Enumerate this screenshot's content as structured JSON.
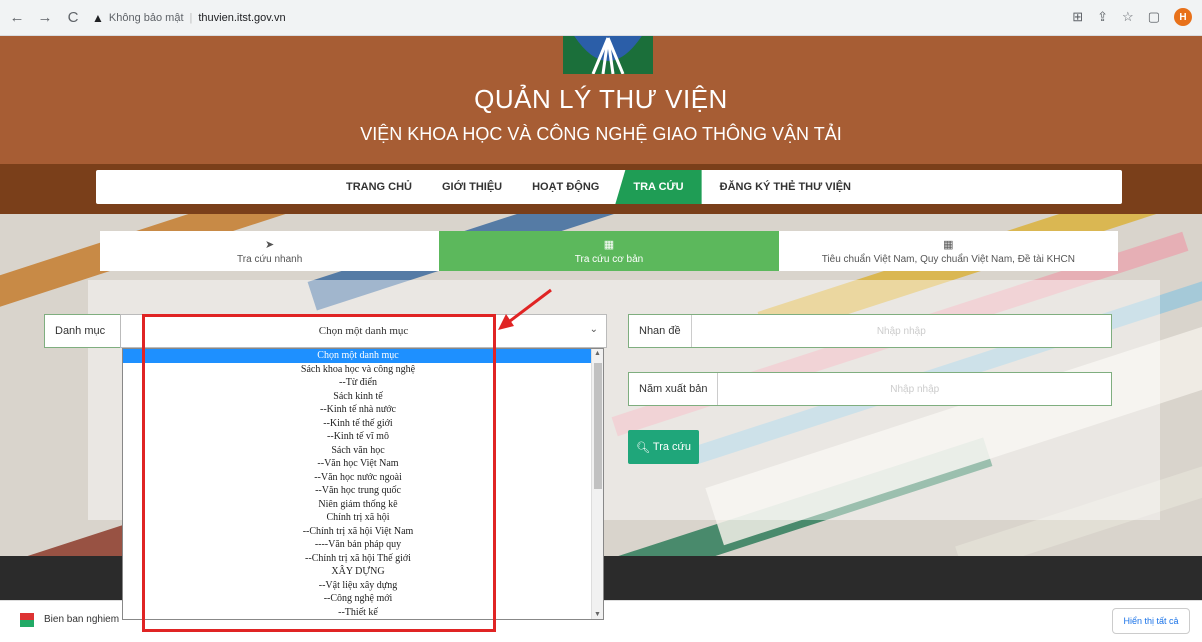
{
  "browser": {
    "security_label": "Không bảo mật",
    "url": "thuvien.itst.gov.vn",
    "avatar_letter": "H"
  },
  "header": {
    "title": "QUẢN LÝ THƯ VIỆN",
    "subtitle": "VIỆN KHOA HỌC VÀ CÔNG NGHỆ GIAO THÔNG VẬN TẢI"
  },
  "nav": {
    "items": [
      "TRANG CHỦ",
      "GIỚI THIỆU",
      "HOẠT ĐỘNG",
      "TRA CỨU",
      "ĐĂNG KÝ THẺ THƯ VIỆN"
    ],
    "active": "TRA CỨU"
  },
  "tabs": [
    {
      "label": "Tra cứu nhanh",
      "icon": "send-icon"
    },
    {
      "label": "Tra cứu cơ bản",
      "icon": "table-icon"
    },
    {
      "label": "Tiêu chuẩn Việt Nam, Quy chuẩn Việt Nam, Đề tài KHCN",
      "icon": "table-icon"
    }
  ],
  "form": {
    "category_label": "Danh mục",
    "category_selected": "Chọn một danh mục",
    "title_label": "Nhan đề",
    "title_placeholder": "Nhập nhập",
    "year_label": "Năm xuất bản",
    "year_placeholder": "Nhập nhập",
    "search_button": "Tra cứu"
  },
  "dropdown_options": [
    "Chọn một danh mục",
    "Sách khoa học và công nghệ",
    "--Từ điển",
    "Sách kinh tế",
    "--Kinh tế nhà nước",
    "--Kinh tế thế giới",
    "--Kinh tế vĩ mô",
    "Sách văn học",
    "--Văn học Việt Nam",
    "--Văn học nước ngoài",
    "--Văn học trung quốc",
    "Niên giám thống kê",
    "Chính trị xã hội",
    "--Chính trị xã hội Việt Nam",
    "----Văn bản pháp quy",
    "--Chính trị xã hội Thế giới",
    "XÂY DỰNG",
    "--Vật liệu xây dựng",
    "--Công nghệ mới",
    "--Thiết kế"
  ],
  "downloads": {
    "file_name": "Bien ban nghiem",
    "show_all": "Hiển thị tất cả"
  },
  "colors": {
    "header": "#a75d34",
    "accent_green": "#1f9d55",
    "highlight_red": "#e02424",
    "selected_option": "#1e90ff"
  }
}
